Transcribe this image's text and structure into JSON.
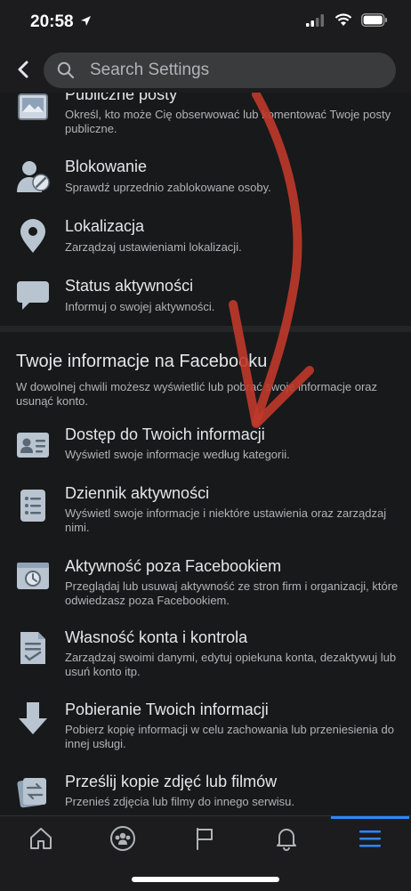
{
  "status": {
    "time": "20:58"
  },
  "search": {
    "placeholder": "Search Settings"
  },
  "items_top": [
    {
      "title": "Publiczne posty",
      "desc": "Określ, kto może Cię obserwować lub komentować Twoje posty publiczne.",
      "icon": "public-posts-icon"
    },
    {
      "title": "Blokowanie",
      "desc": "Sprawdź uprzednio zablokowane osoby.",
      "icon": "blocking-icon"
    },
    {
      "title": "Lokalizacja",
      "desc": "Zarządzaj ustawieniami lokalizacji.",
      "icon": "location-pin-icon"
    },
    {
      "title": "Status aktywności",
      "desc": "Informuj o swojej aktywności.",
      "icon": "chat-bubble-icon"
    }
  ],
  "section": {
    "title": "Twoje informacje na Facebooku",
    "desc": "W dowolnej chwili możesz wyświetlić lub pobrać swoje informacje oraz usunąć konto."
  },
  "items_info": [
    {
      "title": "Dostęp do Twoich informacji",
      "desc": "Wyświetl swoje informacje według kategorii.",
      "icon": "id-card-icon"
    },
    {
      "title": "Dziennik aktywności",
      "desc": "Wyświetl swoje informacje i niektóre ustawienia oraz zarządzaj nimi.",
      "icon": "activity-log-icon"
    },
    {
      "title": "Aktywność poza Facebookiem",
      "desc": "Przeglądaj lub usuwaj aktywność ze stron firm i organizacji, które odwiedzasz poza Facebookiem.",
      "icon": "off-facebook-activity-icon"
    },
    {
      "title": "Własność konta i kontrola",
      "desc": "Zarządzaj swoimi danymi, edytuj opiekuna konta, dezaktywuj lub usuń konto itp.",
      "icon": "document-check-icon"
    },
    {
      "title": "Pobieranie Twoich informacji",
      "desc": "Pobierz kopię informacji w celu zachowania lub przeniesienia do innej usługi.",
      "icon": "download-arrow-icon"
    },
    {
      "title": "Prześlij kopie zdjęć lub filmów",
      "desc": "Przenieś zdjęcia lub filmy do innego serwisu.",
      "icon": "transfer-photos-icon"
    }
  ],
  "tabs": [
    {
      "name": "home-icon"
    },
    {
      "name": "groups-icon"
    },
    {
      "name": "pages-flag-icon"
    },
    {
      "name": "notifications-bell-icon"
    },
    {
      "name": "menu-icon",
      "active": true
    }
  ],
  "colors": {
    "accent": "#2d88ff",
    "background": "#18191a",
    "annotation": "#c0392b"
  }
}
